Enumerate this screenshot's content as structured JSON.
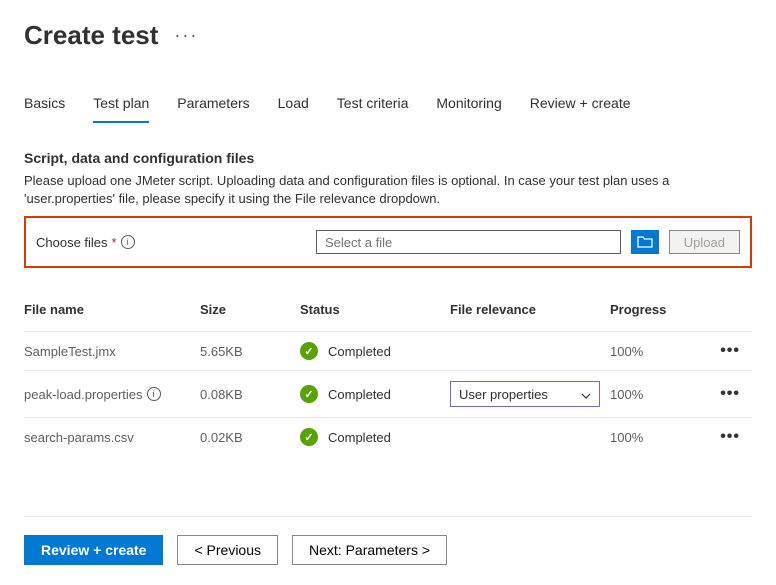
{
  "header": {
    "title": "Create test"
  },
  "tabs": [
    {
      "label": "Basics",
      "active": false
    },
    {
      "label": "Test plan",
      "active": true
    },
    {
      "label": "Parameters",
      "active": false
    },
    {
      "label": "Load",
      "active": false
    },
    {
      "label": "Test criteria",
      "active": false
    },
    {
      "label": "Monitoring",
      "active": false
    },
    {
      "label": "Review + create",
      "active": false
    }
  ],
  "section": {
    "title": "Script, data and configuration files",
    "description": "Please upload one JMeter script. Uploading data and configuration files is optional. In case your test plan uses a 'user.properties' file, please specify it using the File relevance dropdown."
  },
  "upload": {
    "choose_label": "Choose files",
    "placeholder": "Select a file",
    "upload_button": "Upload"
  },
  "table": {
    "headers": {
      "name": "File name",
      "size": "Size",
      "status": "Status",
      "relevance": "File relevance",
      "progress": "Progress"
    },
    "rows": [
      {
        "name": "SampleTest.jmx",
        "size": "5.65KB",
        "status": "Completed",
        "relevance": null,
        "progress": "100%",
        "has_info": false
      },
      {
        "name": "peak-load.properties",
        "size": "0.08KB",
        "status": "Completed",
        "relevance": "User properties",
        "progress": "100%",
        "has_info": true
      },
      {
        "name": "search-params.csv",
        "size": "0.02KB",
        "status": "Completed",
        "relevance": null,
        "progress": "100%",
        "has_info": false
      }
    ]
  },
  "footer": {
    "review_create": "Review + create",
    "previous": "< Previous",
    "next": "Next: Parameters >"
  }
}
